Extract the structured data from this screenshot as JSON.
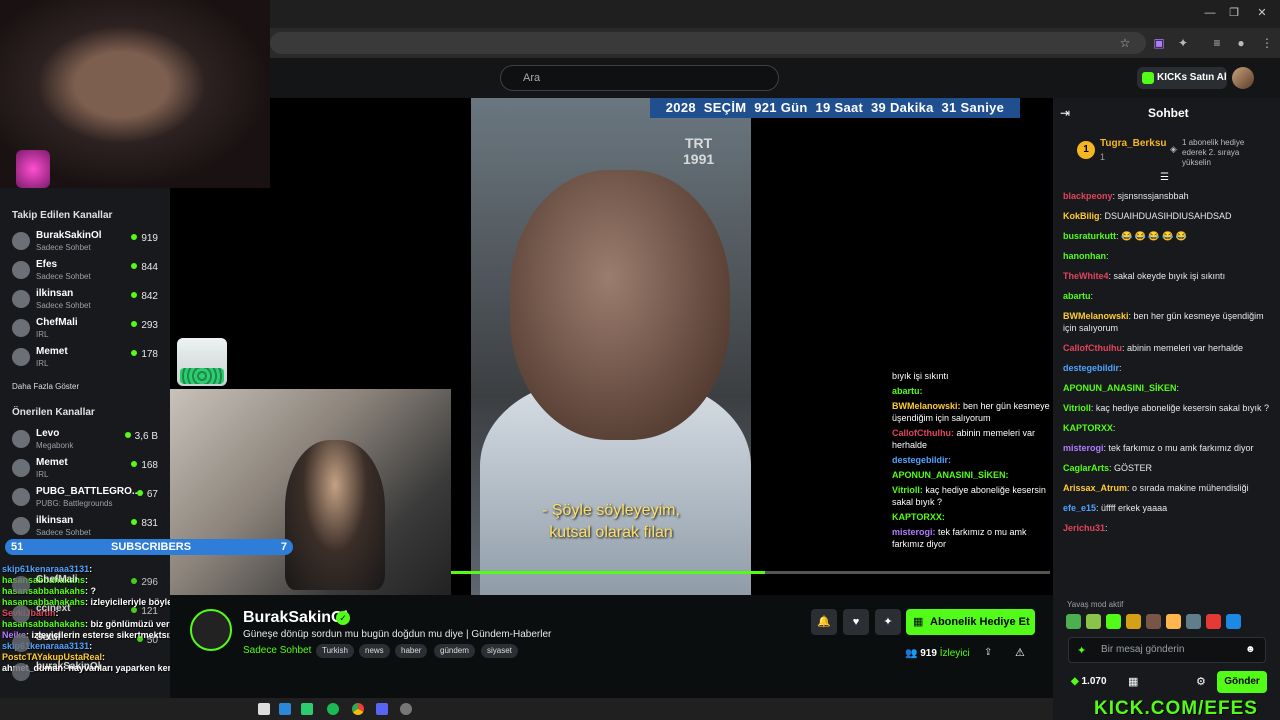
{
  "browser": {
    "window_controls": [
      "—",
      "❐",
      "✕"
    ]
  },
  "header": {
    "search_placeholder": "Ara",
    "buy_kicks_label": "KICKs Satın Al"
  },
  "sidebar": {
    "followed_title": "Takip Edilen Kanallar",
    "followed": [
      {
        "name": "BurakSakinOl",
        "category": "Sadece Sohbet",
        "viewers": "919"
      },
      {
        "name": "Efes",
        "category": "Sadece Sohbet",
        "viewers": "844"
      },
      {
        "name": "ilkinsan",
        "category": "Sadece Sohbet",
        "viewers": "842"
      },
      {
        "name": "ChefMali",
        "category": "IRL",
        "viewers": "293"
      },
      {
        "name": "Memet",
        "category": "IRL",
        "viewers": "178"
      }
    ],
    "show_more": "Daha Fazla Göster",
    "recommended_title": "Önerilen Kanallar",
    "recommended": [
      {
        "name": "Levo",
        "category": "Megabonk",
        "viewers": "3,6 B"
      },
      {
        "name": "Memet",
        "category": "IRL",
        "viewers": "168"
      },
      {
        "name": "PUBG_BATTLEGRO...",
        "category": "PUBG: Battlegrounds",
        "viewers": "67"
      },
      {
        "name": "ilkinsan",
        "category": "Sadece Sohbet",
        "viewers": "831"
      }
    ],
    "partial_items": [
      {
        "name": "ChefMali",
        "viewers": "296"
      },
      {
        "name": "ccinext",
        "viewers": "121"
      },
      {
        "name": "Setul",
        "viewers": "50"
      },
      {
        "name": "burakSakinOl",
        "viewers": ""
      }
    ]
  },
  "video": {
    "countdown": [
      "2028",
      "SEÇİM",
      "921",
      "Gün",
      "19",
      "Saat",
      "39",
      "Dakika",
      "31",
      "Saniye"
    ],
    "channel_logo": [
      "TRT",
      "1991"
    ],
    "subtitle_line1": "- Şöyle söyleyeyim,",
    "subtitle_line2": "kutsal olarak filan",
    "overlay_chat": [
      {
        "user": "",
        "text": "bıyık işi sıkıntı",
        "color": "#ffffff"
      },
      {
        "user": "abartu:",
        "text": "",
        "color": "#53fc18"
      },
      {
        "user": "BWMelanowski:",
        "text": "ben her gün kesmeye üşendiğim için salıyorum",
        "color": "#ffcc33"
      },
      {
        "user": "CallofCthulhu:",
        "text": "abinin memeleri var herhalde",
        "color": "#e0455c"
      },
      {
        "user": "destegebildir:",
        "text": "",
        "color": "#4fa3ff"
      },
      {
        "user": "APONUN_ANASINI_SİKEN:",
        "text": "",
        "color": "#53fc18"
      },
      {
        "user": "Vitrioll:",
        "text": "kaç hediye aboneliğe kesersin sakal bıyık ?",
        "color": "#53fc18"
      },
      {
        "user": "KAPTORXX:",
        "text": "",
        "color": "#53fc18"
      },
      {
        "user": "misterogi:",
        "text": "tek farkımız o mu amk farkımız diyor",
        "color": "#b07cff"
      }
    ]
  },
  "subscribers_bar": {
    "left": "51",
    "label": "SUBSCRIBERS",
    "right": "7"
  },
  "overlay_chat_left": [
    {
      "user": "skip61kenaraaa3131",
      "text": ":",
      "color": "#4fa3ff"
    },
    {
      "user": "hasansabbahakahs",
      "text": ":",
      "color": "#53fc18"
    },
    {
      "user": "hasansabbahakahs",
      "text": ": ?",
      "color": "#53fc18"
    },
    {
      "user": "hasansabbahakahs",
      "text": ": izleyicileriyle böyle mi konuşuyor bu",
      "color": "#53fc18"
    },
    {
      "user": "SevkiJbartin",
      "text": ":",
      "color": "#e0455c"
    },
    {
      "user": "hasansabbahakahs",
      "text": ": biz gönlümüzü verdik sana dostum",
      "color": "#53fc18"
    },
    {
      "user": "Neike",
      "text": ": izleyicilerin esterse sikertmektsızsan gidersin",
      "color": "#b07cff"
    },
    {
      "user": "skip61kenaraaa3131",
      "text": ":",
      "color": "#4fa3ff"
    },
    {
      "user": "PostcTAYakupUstaReal",
      "text": ":",
      "color": "#ffcc33"
    },
    {
      "user": "ahmet_duman",
      "text": ": hayvanları yaparken kendini şey ediyor musun?",
      "color": "#ffffff"
    }
  ],
  "stream": {
    "streamer": "BurakSakinOl",
    "title": "Güneşe dönüp sordun mu bugün doğdun mu diye | Gündem-Haberler",
    "category": "Sadece Sohbet",
    "tags": [
      "Turkish",
      "news",
      "haber",
      "gündem",
      "siyaset"
    ],
    "subgift_label": "Abonelik Hediye Et",
    "viewers": "919",
    "viewers_label": "İzleyici"
  },
  "chat": {
    "title": "Sohbet",
    "pinned": {
      "rank": "1",
      "user": "Tugra_Berksu",
      "count": "1",
      "message": "1 abonelik hediye ederek 2. sıraya yükselin"
    },
    "messages": [
      {
        "user": "blackpeony",
        "text": ": sjsnsnssjansbbah",
        "color": "#e0455c"
      },
      {
        "user": "KokBilig",
        "text": ": DSUAIHDUASIHDIUSAHDSAD",
        "color": "#ffcc33"
      },
      {
        "user": "busraturkutt",
        "text": ": 😂 😂 😂 😂 😂",
        "color": "#53fc18"
      },
      {
        "user": "hanonhan",
        "text": ":",
        "color": "#53fc18"
      },
      {
        "user": "TheWhite4",
        "text": ": sakal okeyde bıyık işi sıkıntı",
        "color": "#e0455c"
      },
      {
        "user": "abartu",
        "text": ":",
        "color": "#53fc18"
      },
      {
        "user": "BWMelanowski",
        "text": ": ben her gün kesmeye üşendiğim için salıyorum",
        "color": "#ffcc33"
      },
      {
        "user": "CallofCthulhu",
        "text": ": abinin memeleri var herhalde",
        "color": "#e0455c"
      },
      {
        "user": "destegebildir",
        "text": ":",
        "color": "#4fa3ff"
      },
      {
        "user": "APONUN_ANASINI_SİKEN",
        "text": ":",
        "color": "#53fc18"
      },
      {
        "user": "Vitrioll",
        "text": ": kaç hediye aboneliğe kesersin sakal bıyık ?",
        "color": "#53fc18"
      },
      {
        "user": "KAPTORXX",
        "text": ":",
        "color": "#53fc18"
      },
      {
        "user": "misterogi",
        "text": ": tek farkımız o mu amk farkımız diyor",
        "color": "#b07cff"
      },
      {
        "user": "CaglarArts",
        "text": ": GÖSTER",
        "color": "#53fc18"
      },
      {
        "user": "Arissax_Atrum",
        "text": ": o sırada makine mühendisliği",
        "color": "#ffcc33"
      },
      {
        "user": "efe_e15",
        "text": ": üffff erkek yaaaa",
        "color": "#4fa3ff"
      },
      {
        "user": "Jerichu31",
        "text": ":",
        "color": "#e0455c"
      }
    ],
    "slow_mode": "Yavaş mod aktif",
    "input_placeholder": "Bir mesaj gönderin",
    "kicks_balance": "1.070",
    "send_label": "Gönder"
  },
  "watermark": "KICK.COM/EFES",
  "colors": {
    "accent": "#53fc18",
    "countdown_bg": "#1f4f8f",
    "subscribers_bg": "#2e7dd8"
  }
}
